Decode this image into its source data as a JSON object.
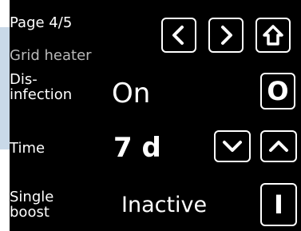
{
  "header": {
    "page_label": "Page 4/5",
    "title": "Grid heater"
  },
  "nav": {
    "prev_icon": "chevron-left-icon",
    "next_icon": "chevron-right-icon",
    "home_icon": "home-outline-icon"
  },
  "rows": [
    {
      "label": "Dis-\ninfection",
      "value": "On",
      "button_label": "O"
    },
    {
      "label": "Time",
      "value": "7 d",
      "down_icon": "chevron-down-icon",
      "up_icon": "chevron-up-icon"
    },
    {
      "label": "Single\nboost",
      "value": "Inactive",
      "button_label": "I"
    }
  ],
  "colors": {
    "screen_bg": "#000000",
    "text": "#ffffff",
    "title_text": "#b9b9b9",
    "accent_bar": "#c9d9e8"
  }
}
